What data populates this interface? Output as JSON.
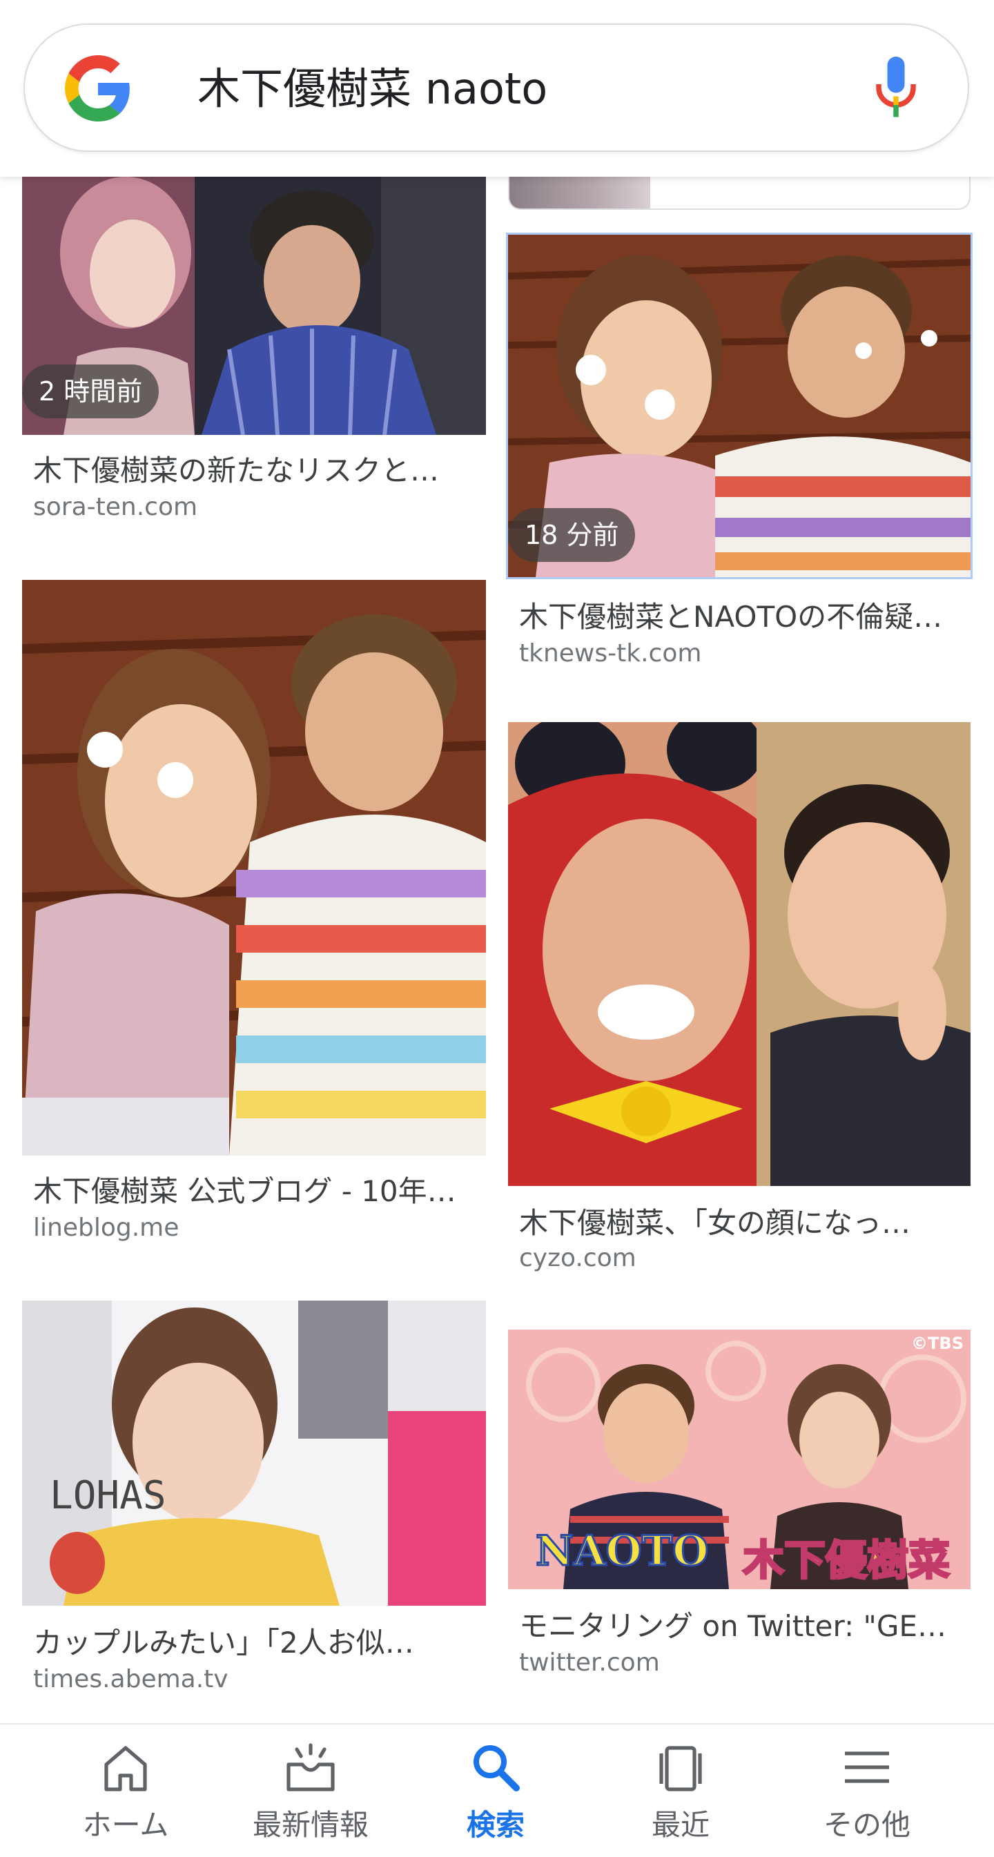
{
  "search": {
    "query": "木下優樹菜 naoto"
  },
  "results": [
    {
      "title": "木下優樹菜の新たなリスクと…",
      "domain": "sora-ten.com",
      "badge": "2 時間前"
    },
    {
      "title": "木下優樹菜とNAOTOの不倫疑…",
      "domain": "tknews-tk.com",
      "badge": "18 分前"
    },
    {
      "title": "木下優樹菜 公式ブログ - 10年…",
      "domain": "lineblog.me",
      "badge": ""
    },
    {
      "title": "木下優樹菜、「女の顔になっ…",
      "domain": "cyzo.com",
      "badge": ""
    },
    {
      "title": "カップルみたい」「2人お似…",
      "domain": "times.abema.tv",
      "badge": ""
    },
    {
      "title": "モニタリング on Twitter: \"GE…",
      "domain": "twitter.com",
      "badge": ""
    }
  ],
  "image_text": {
    "tbs_mark": "©TBS",
    "caption_left": "NAOTO",
    "caption_right": "木下優樹菜",
    "lohas": "LOHAS"
  },
  "bottom_nav": {
    "items": [
      {
        "label": "ホーム",
        "icon": "home-icon"
      },
      {
        "label": "最新情報",
        "icon": "updates-icon"
      },
      {
        "label": "検索",
        "icon": "search-icon"
      },
      {
        "label": "最近",
        "icon": "recent-icon"
      },
      {
        "label": "その他",
        "icon": "menu-icon"
      }
    ],
    "active_index": 2
  },
  "colors": {
    "accent": "#1a73e8",
    "google_blue": "#4285F4",
    "google_red": "#EA4335",
    "google_yellow": "#FBBC05",
    "google_green": "#34A853"
  }
}
